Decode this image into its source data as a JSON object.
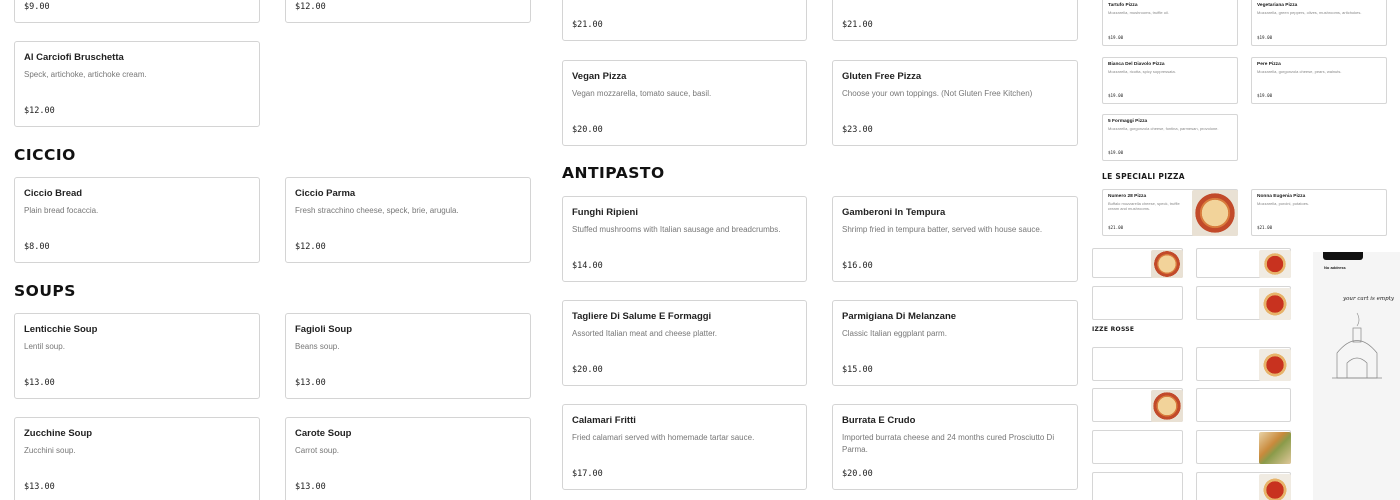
{
  "col1": {
    "top_prices": [
      "$9.00",
      "$12.00"
    ],
    "bruschetta": {
      "name": "Al Carciofi Bruschetta",
      "desc": "Speck, artichoke, artichoke cream.",
      "price": "$12.00"
    },
    "ciccio": {
      "title": "CICCIO",
      "items": [
        {
          "name": "Ciccio Bread",
          "desc": "Plain bread focaccia.",
          "price": "$8.00"
        },
        {
          "name": "Ciccio Parma",
          "desc": "Fresh stracchino cheese, speck, brie, arugula.",
          "price": "$12.00"
        }
      ]
    },
    "soups": {
      "title": "SOUPS",
      "items": [
        {
          "name": "Lenticchie Soup",
          "desc": "Lentil soup.",
          "price": "$13.00"
        },
        {
          "name": "Fagioli Soup",
          "desc": "Beans soup.",
          "price": "$13.00"
        },
        {
          "name": "Zucchine Soup",
          "desc": "Zucchini soup.",
          "price": "$13.00"
        },
        {
          "name": "Carote Soup",
          "desc": "Carrot soup.",
          "price": "$13.00"
        }
      ]
    }
  },
  "col2": {
    "top_prices": [
      "$21.00",
      "$21.00"
    ],
    "pizzas": [
      {
        "name": "Vegan Pizza",
        "desc": "Vegan mozzarella, tomato sauce, basil.",
        "price": "$20.00"
      },
      {
        "name": "Gluten Free Pizza",
        "desc": "Choose your own toppings. (Not Gluten Free Kitchen)",
        "price": "$23.00"
      }
    ],
    "antipasto": {
      "title": "ANTIPASTO",
      "items": [
        {
          "name": "Funghi Ripieni",
          "desc": "Stuffed mushrooms with Italian sausage and breadcrumbs.",
          "price": "$14.00"
        },
        {
          "name": "Gamberoni In Tempura",
          "desc": "Shrimp fried in tempura batter, served with house sauce.",
          "price": "$16.00"
        },
        {
          "name": "Tagliere Di Salume E Formaggi",
          "desc": "Assorted Italian meat and cheese platter.",
          "price": "$20.00"
        },
        {
          "name": "Parmigiana Di Melanzane",
          "desc": "Classic Italian eggplant parm.",
          "price": "$15.00"
        },
        {
          "name": "Calamari Fritti",
          "desc": "Fried calamari served with homemade tartar sauce.",
          "price": "$17.00"
        },
        {
          "name": "Burrata E Crudo",
          "desc": "Imported burrata cheese and 24 months cured Prosciutto Di Parma.",
          "price": "$20.00"
        }
      ]
    }
  },
  "col3": {
    "minis": [
      {
        "name": "Tartufo Pizza",
        "desc": "Mozzarella, mushrooms, truffle oil.",
        "price": "$19.00"
      },
      {
        "name": "Vegetariana Pizza",
        "desc": "Mozzarella, green peppers, olives, mushrooms, artichokes.",
        "price": "$19.00"
      },
      {
        "name": "Bianca Del Diavolo Pizza",
        "desc": "Mozzarella, ricotta, spicy soppressata.",
        "price": "$19.00"
      },
      {
        "name": "Pere Pizza",
        "desc": "Mozzarella, gorgonzola cheese, pears, walnuts.",
        "price": "$19.00"
      },
      {
        "name": "5 Formaggi Pizza",
        "desc": "Mozzarella, gorgonzola cheese, fontina, parmesan, provolone.",
        "price": "$19.00"
      }
    ],
    "speciali_title": "LE SPECIALI PIZZA",
    "speciali": [
      {
        "name": "Numero 28 Pizza",
        "desc": "Buffalo mozzarella cheese, speck, truffle cream and mushrooms.",
        "price": "$21.00"
      },
      {
        "name": "Nonna Eugenia Pizza",
        "desc": "Mozzarella, porcini, potatoes.",
        "price": "$21.00"
      }
    ],
    "rosse_title": "IZZE ROSSE",
    "phone": {
      "address": "No address",
      "empty": "your cart is empty"
    }
  }
}
